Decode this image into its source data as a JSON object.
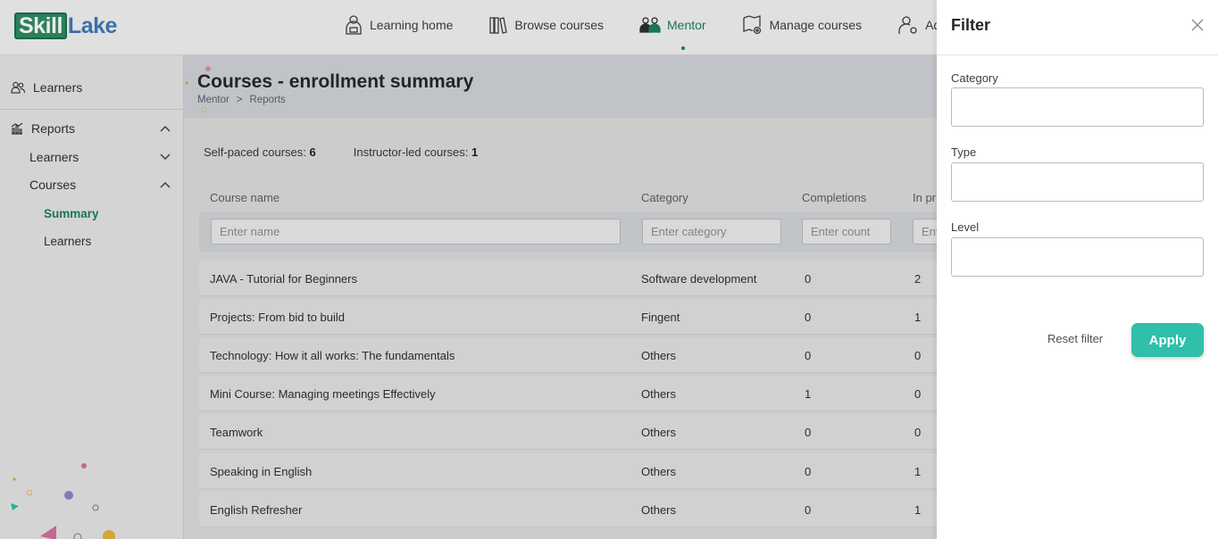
{
  "brand": {
    "part1": "Skill",
    "part2": "Lake"
  },
  "nav": {
    "items": [
      {
        "label": "Learning home",
        "icon": "learner-icon"
      },
      {
        "label": "Browse courses",
        "icon": "books-icon"
      },
      {
        "label": "Mentor",
        "icon": "mentor-icon",
        "active": true
      },
      {
        "label": "Manage courses",
        "icon": "manage-courses-icon"
      },
      {
        "label": "Ad",
        "icon": "admin-icon"
      }
    ]
  },
  "sidebar": {
    "learners": "Learners",
    "reports": "Reports",
    "reports_learners": "Learners",
    "reports_courses": "Courses",
    "summary": "Summary",
    "courses_learners": "Learners"
  },
  "page": {
    "title": "Courses - enrollment summary",
    "breadcrumb": [
      "Mentor",
      "Reports"
    ],
    "breadcrumb_sep": ">",
    "self_paced_label": "Self-paced courses:",
    "self_paced_count": "6",
    "instructor_led_label": "Instructor-led courses:",
    "instructor_led_count": "1"
  },
  "table": {
    "columns": [
      "Course name",
      "Category",
      "Completions",
      "In pr"
    ],
    "filters": {
      "name": "Enter name",
      "category": "Enter category",
      "count": "Enter count",
      "in_progress": "Ent"
    },
    "rows": [
      {
        "name": "JAVA - Tutorial for Beginners",
        "category": "Software development",
        "completions": "0",
        "in_progress": "2"
      },
      {
        "name": "Projects: From bid to build",
        "category": "Fingent",
        "completions": "0",
        "in_progress": "1"
      },
      {
        "name": "Technology: How it all works: The fundamentals",
        "category": "Others",
        "completions": "0",
        "in_progress": "0"
      },
      {
        "name": "Mini Course: Managing meetings Effectively",
        "category": "Others",
        "completions": "1",
        "in_progress": "0"
      },
      {
        "name": "Teamwork",
        "category": "Others",
        "completions": "0",
        "in_progress": "0"
      },
      {
        "name": "Speaking in English",
        "category": "Others",
        "completions": "0",
        "in_progress": "1"
      },
      {
        "name": "English Refresher",
        "category": "Others",
        "completions": "0",
        "in_progress": "1"
      }
    ]
  },
  "filter_panel": {
    "title": "Filter",
    "category_label": "Category",
    "category_value": "",
    "type_label": "Type",
    "type_value": "",
    "level_label": "Level",
    "level_value": "",
    "reset_label": "Reset filter",
    "apply_label": "Apply"
  },
  "colors": {
    "accent": "#1e7f5d",
    "apply": "#2fbfaa",
    "brand_blue": "#3f7ab8"
  }
}
